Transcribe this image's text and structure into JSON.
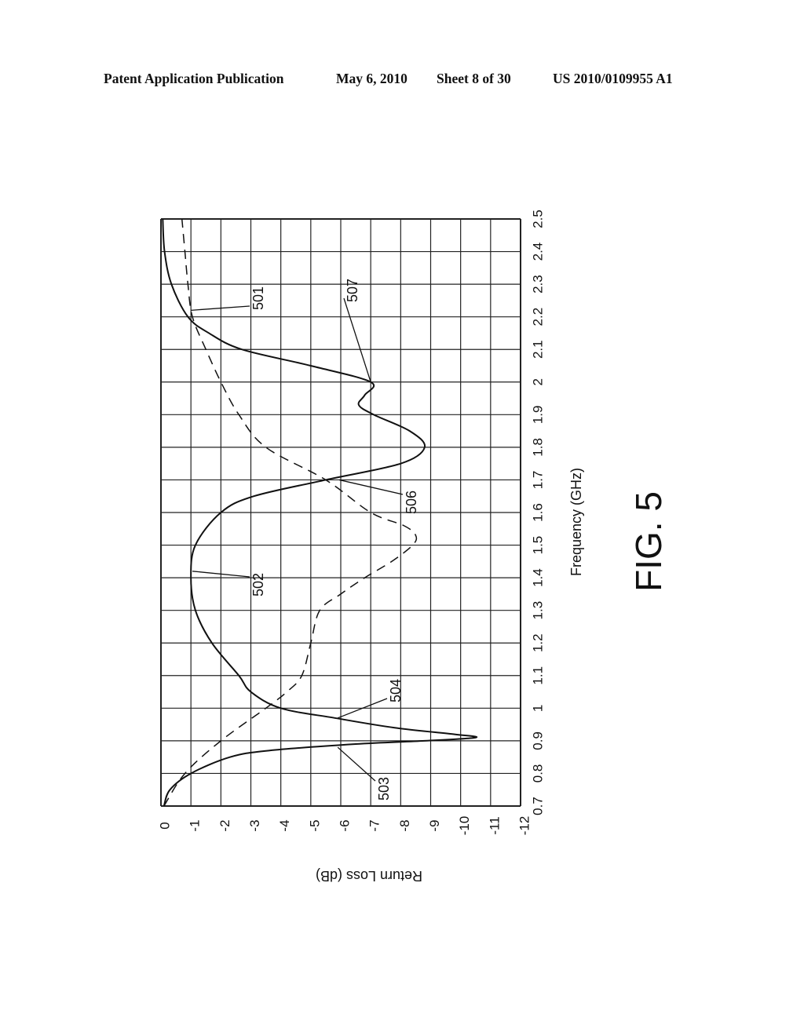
{
  "header": {
    "publication": "Patent Application Publication",
    "date": "May 6, 2010",
    "sheet": "Sheet 8 of 30",
    "number": "US 2010/0109955 A1"
  },
  "figure_label": "FIG. 5",
  "chart_data": {
    "type": "line",
    "title": "",
    "xlabel": "Frequency (GHz)",
    "ylabel": "Return Loss (dB)",
    "xlim": [
      0.7,
      2.5
    ],
    "ylim": [
      -12,
      0
    ],
    "orientation": "rotated 90 degrees counter-clockwise on page",
    "grid": true,
    "x_ticks": [
      "0.7",
      "0.8",
      "0.9",
      "1",
      "1.1",
      "1.2",
      "1.3",
      "1.4",
      "1.5",
      "1.6",
      "1.7",
      "1.8",
      "1.9",
      "2",
      "2.1",
      "2.2",
      "2.3",
      "2.4",
      "2.5"
    ],
    "x_tick_values": [
      0.7,
      0.8,
      0.9,
      1.0,
      1.1,
      1.2,
      1.3,
      1.4,
      1.5,
      1.6,
      1.7,
      1.8,
      1.9,
      2.0,
      2.1,
      2.2,
      2.3,
      2.4,
      2.5
    ],
    "y_ticks": [
      "0",
      "-1",
      "-2",
      "-3",
      "-4",
      "-5",
      "-6",
      "-7",
      "-8",
      "-9",
      "-10",
      "-11",
      "-12"
    ],
    "y_tick_values": [
      0,
      -1,
      -2,
      -3,
      -4,
      -5,
      -6,
      -7,
      -8,
      -9,
      -10,
      -11,
      -12
    ],
    "series": [
      {
        "name": "solid",
        "style": "solid",
        "x": [
          0.7,
          0.75,
          0.8,
          0.85,
          0.87,
          0.89,
          0.9,
          0.91,
          0.92,
          0.94,
          0.97,
          1.0,
          1.05,
          1.1,
          1.2,
          1.3,
          1.4,
          1.5,
          1.6,
          1.65,
          1.7,
          1.75,
          1.8,
          1.85,
          1.9,
          1.93,
          1.96,
          2.0,
          2.05,
          2.1,
          2.15,
          2.2,
          2.3,
          2.4,
          2.5
        ],
        "y": [
          -0.1,
          -0.3,
          -1.0,
          -2.3,
          -3.6,
          -6.5,
          -8.8,
          -10.5,
          -9.8,
          -7.8,
          -5.8,
          -4.0,
          -3.0,
          -2.6,
          -1.7,
          -1.15,
          -1.0,
          -1.15,
          -2.0,
          -3.1,
          -5.5,
          -8.0,
          -8.8,
          -8.3,
          -7.1,
          -6.6,
          -6.8,
          -7.0,
          -5.0,
          -2.7,
          -1.6,
          -0.9,
          -0.35,
          -0.12,
          -0.06
        ]
      },
      {
        "name": "dashed",
        "style": "dashed",
        "x": [
          0.7,
          0.8,
          0.9,
          1.0,
          1.05,
          1.1,
          1.2,
          1.3,
          1.35,
          1.4,
          1.45,
          1.5,
          1.53,
          1.56,
          1.6,
          1.7,
          1.8,
          1.9,
          2.0,
          2.1,
          2.2,
          2.3,
          2.4,
          2.5
        ],
        "y": [
          -0.1,
          -0.8,
          -2.0,
          -3.5,
          -4.2,
          -4.7,
          -5.0,
          -5.3,
          -6.0,
          -6.8,
          -7.7,
          -8.4,
          -8.5,
          -8.1,
          -7.0,
          -5.5,
          -3.5,
          -2.6,
          -2.0,
          -1.5,
          -1.05,
          -0.9,
          -0.8,
          -0.7
        ]
      }
    ],
    "annotations": [
      {
        "label": "501",
        "points_to": {
          "x": 2.22,
          "y": -1.0
        }
      },
      {
        "label": "502",
        "points_to": {
          "x": 1.42,
          "y": -1.05
        }
      },
      {
        "label": "503",
        "points_to": {
          "x": 0.88,
          "y": -5.9
        }
      },
      {
        "label": "504",
        "points_to": {
          "x": 0.97,
          "y": -5.9
        }
      },
      {
        "label": "506",
        "points_to": {
          "x": 1.7,
          "y": -5.95
        }
      },
      {
        "label": "507",
        "points_to": {
          "x": 2.0,
          "y": -7.0
        }
      }
    ]
  }
}
